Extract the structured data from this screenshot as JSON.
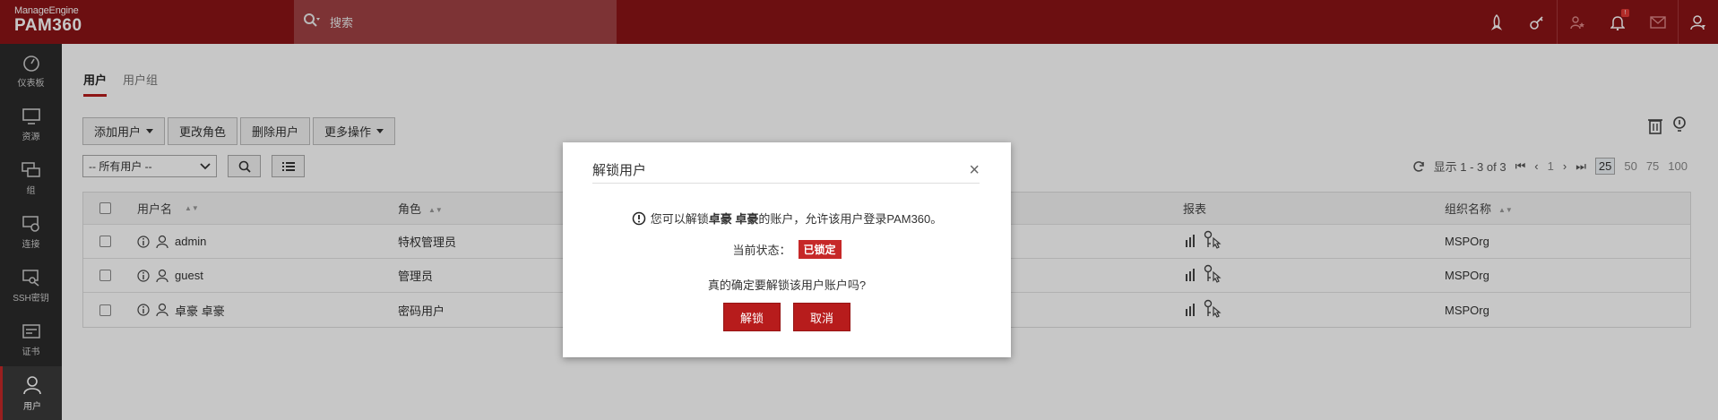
{
  "brand": {
    "company": "ManageEngine",
    "product": "PAM360"
  },
  "search": {
    "placeholder": "搜索"
  },
  "sidebar": {
    "items": [
      {
        "label": "仪表板",
        "icon": "dashboard-icon"
      },
      {
        "label": "资源",
        "icon": "monitor-icon"
      },
      {
        "label": "组",
        "icon": "group-icon"
      },
      {
        "label": "连接",
        "icon": "connection-icon"
      },
      {
        "label": "SSH密钥",
        "icon": "ssh-key-icon"
      },
      {
        "label": "证书",
        "icon": "certificate-icon"
      },
      {
        "label": "用户",
        "icon": "user-icon"
      }
    ]
  },
  "header_badge": "!",
  "tabs": [
    {
      "label": "用户"
    },
    {
      "label": "用户组"
    }
  ],
  "toolbar": {
    "add_user": "添加用户",
    "change_role": "更改角色",
    "delete_user": "删除用户",
    "more_actions": "更多操作"
  },
  "filter": {
    "selected": "-- 所有用户 --"
  },
  "pager": {
    "display": "显示 1 - 3 of 3",
    "page": "1",
    "sizes": [
      "25",
      "50",
      "75",
      "100"
    ]
  },
  "table": {
    "headers": [
      "用户名",
      "角色",
      "报表",
      "组织名称"
    ],
    "rows": [
      {
        "username": "admin",
        "role": "特权管理员",
        "org": "MSPOrg"
      },
      {
        "username": "guest",
        "role": "管理员",
        "org": "MSPOrg"
      },
      {
        "username": "卓豪 卓豪",
        "role": "密码用户",
        "org": "MSPOrg"
      }
    ]
  },
  "modal": {
    "title": "解锁用户",
    "close": "×",
    "message_prefix": "您可以解锁",
    "message_user": "卓豪 卓豪",
    "message_suffix": "的账户，允许该用户登录PAM360。",
    "status_label": "当前状态：",
    "status_value": "已锁定",
    "confirm": "真的确定要解锁该用户账户吗?",
    "unlock": "解锁",
    "cancel": "取消"
  }
}
